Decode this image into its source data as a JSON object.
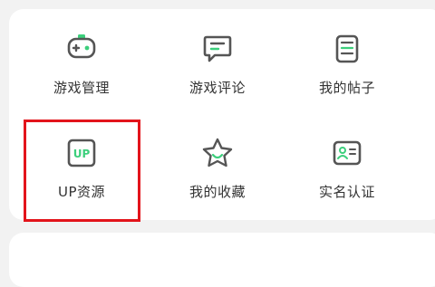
{
  "menu": {
    "items": [
      {
        "label": "游戏管理",
        "icon": "gamepad-icon"
      },
      {
        "label": "游戏评论",
        "icon": "comment-icon"
      },
      {
        "label": "我的帖子",
        "icon": "document-icon"
      },
      {
        "label": "UP资源",
        "icon": "up-resource-icon"
      },
      {
        "label": "我的收藏",
        "icon": "star-icon"
      },
      {
        "label": "实名认证",
        "icon": "id-card-icon"
      }
    ],
    "up_badge_text": "UP"
  },
  "colors": {
    "accent": "#3ccf7c",
    "icon_stroke": "#555555",
    "highlight_border": "#e3141b"
  }
}
